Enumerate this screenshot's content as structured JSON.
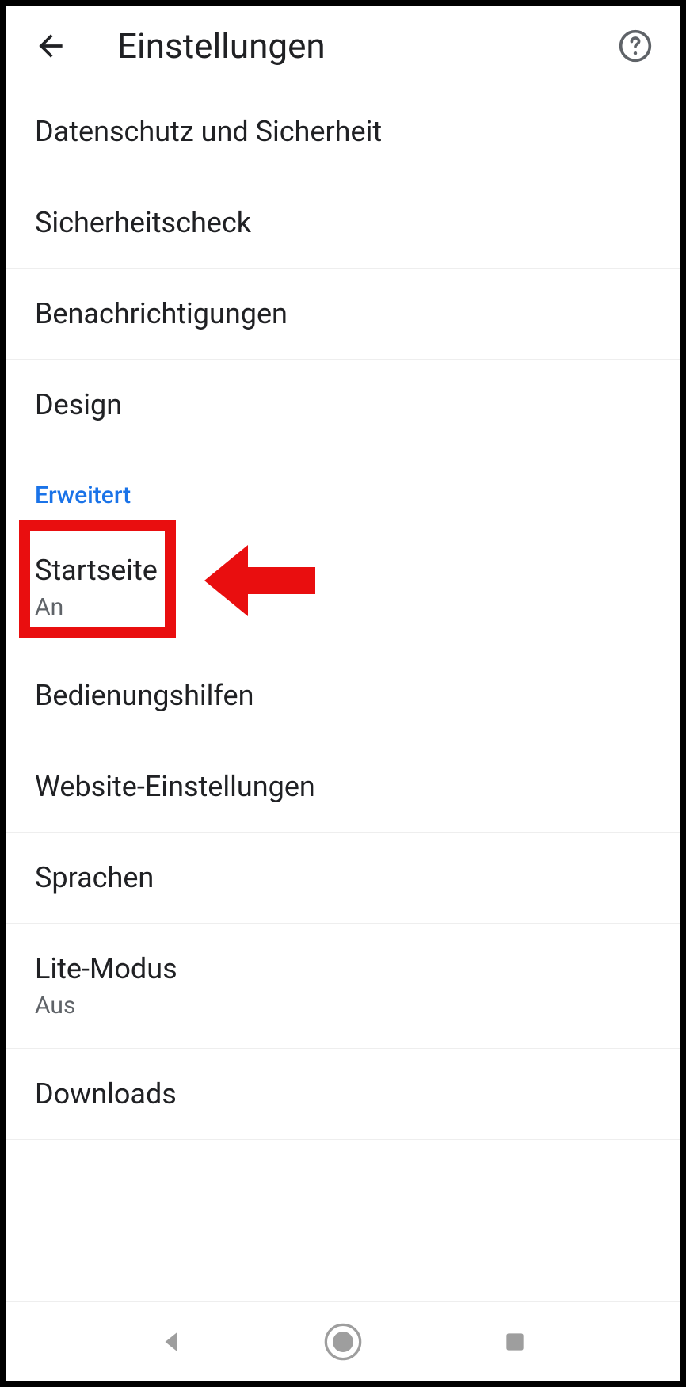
{
  "header": {
    "title": "Einstellungen"
  },
  "items": {
    "privacy": "Datenschutz und Sicherheit",
    "security_check": "Sicherheitscheck",
    "notifications": "Benachrichtigungen",
    "design": "Design"
  },
  "section": {
    "advanced": "Erweitert"
  },
  "advanced_items": {
    "homepage": {
      "title": "Startseite",
      "subtitle": "An"
    },
    "accessibility": "Bedienungshilfen",
    "site_settings": "Website-Einstellungen",
    "languages": "Sprachen",
    "lite_mode": {
      "title": "Lite-Modus",
      "subtitle": "Aus"
    },
    "downloads": "Downloads"
  },
  "annotation": {
    "highlight_color": "#e90e0f"
  }
}
